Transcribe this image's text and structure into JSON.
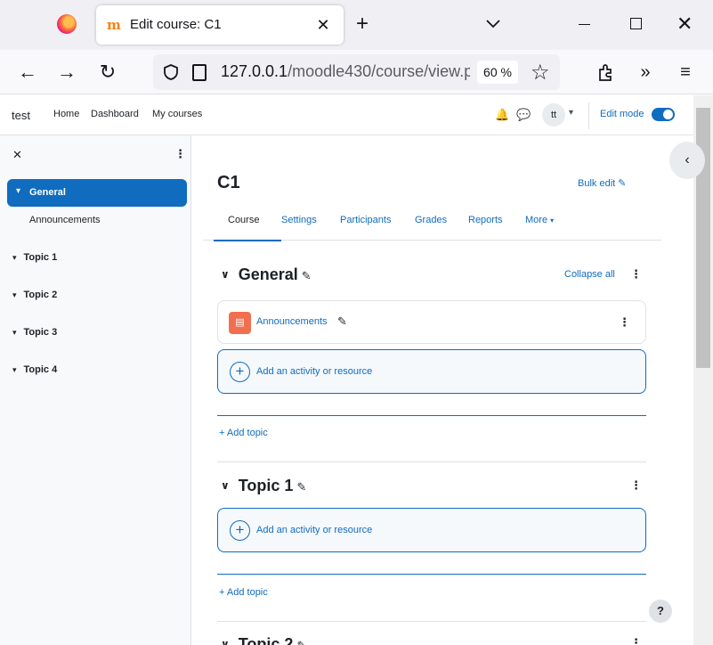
{
  "browser": {
    "tab_title": "Edit course: C1",
    "tab_favicon": "m",
    "url_host": "127.0.0.1",
    "url_path": "/moodle430/course/view.ph",
    "zoom": "60 %"
  },
  "header": {
    "brand": "test",
    "nav": [
      "Home",
      "Dashboard",
      "My courses"
    ],
    "avatar": "tt",
    "edit_mode": "Edit mode"
  },
  "index": {
    "active": "General",
    "sub_item": "Announcements",
    "topics": [
      "Topic 1",
      "Topic 2",
      "Topic 3",
      "Topic 4"
    ]
  },
  "course": {
    "title": "C1",
    "bulk_edit": "Bulk edit",
    "tabs": [
      "Course",
      "Settings",
      "Participants",
      "Grades",
      "Reports",
      "More"
    ],
    "collapse_all": "Collapse all",
    "sections": [
      {
        "title": "General",
        "activity": "Announcements"
      },
      {
        "title": "Topic 1"
      },
      {
        "title": "Topic 2"
      }
    ],
    "add_activity": "Add an activity or resource",
    "add_topic": "Add topic"
  },
  "help": "?"
}
